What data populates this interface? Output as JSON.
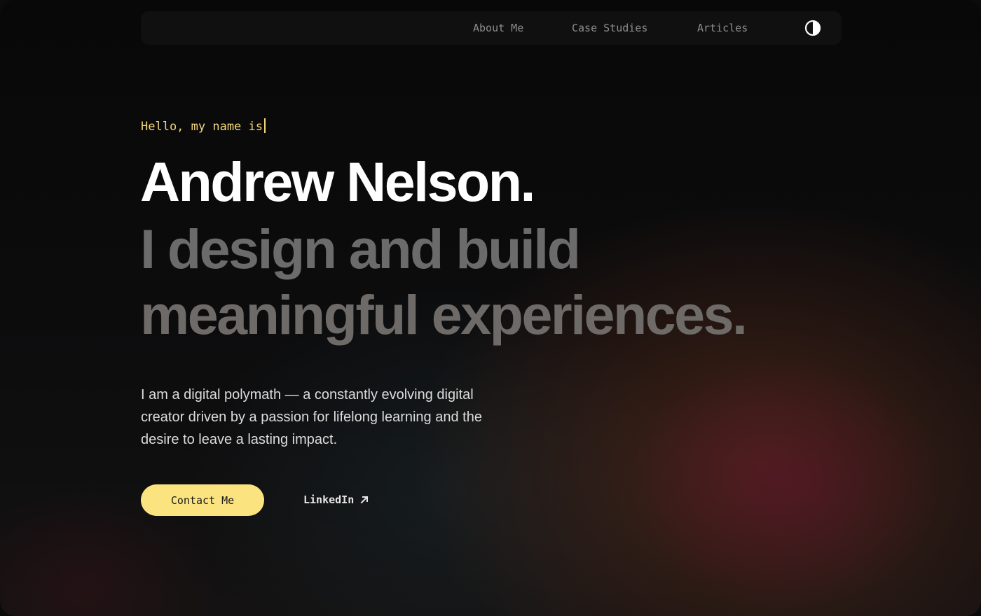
{
  "nav": {
    "links": [
      "About Me",
      "Case Studies",
      "Articles"
    ],
    "theme_toggle_icon": "contrast-icon"
  },
  "hero": {
    "greeting": "Hello, my name is",
    "name": "Andrew Nelson.",
    "tagline_line1": "I design and build",
    "tagline_line2": "meaningful experiences.",
    "intro": "I am a digital polymath — a constantly evolving digital creator driven by a passion for lifelong learning and the desire to leave a lasting impact."
  },
  "actions": {
    "contact_label": "Contact Me",
    "linkedin_label": "LinkedIn",
    "linkedin_icon": "arrow-up-right-icon"
  },
  "colors": {
    "accent": "#fbe37f",
    "greeting": "#f4d77a",
    "heading": "#ffffff",
    "tagline": "#6b6b6b"
  }
}
